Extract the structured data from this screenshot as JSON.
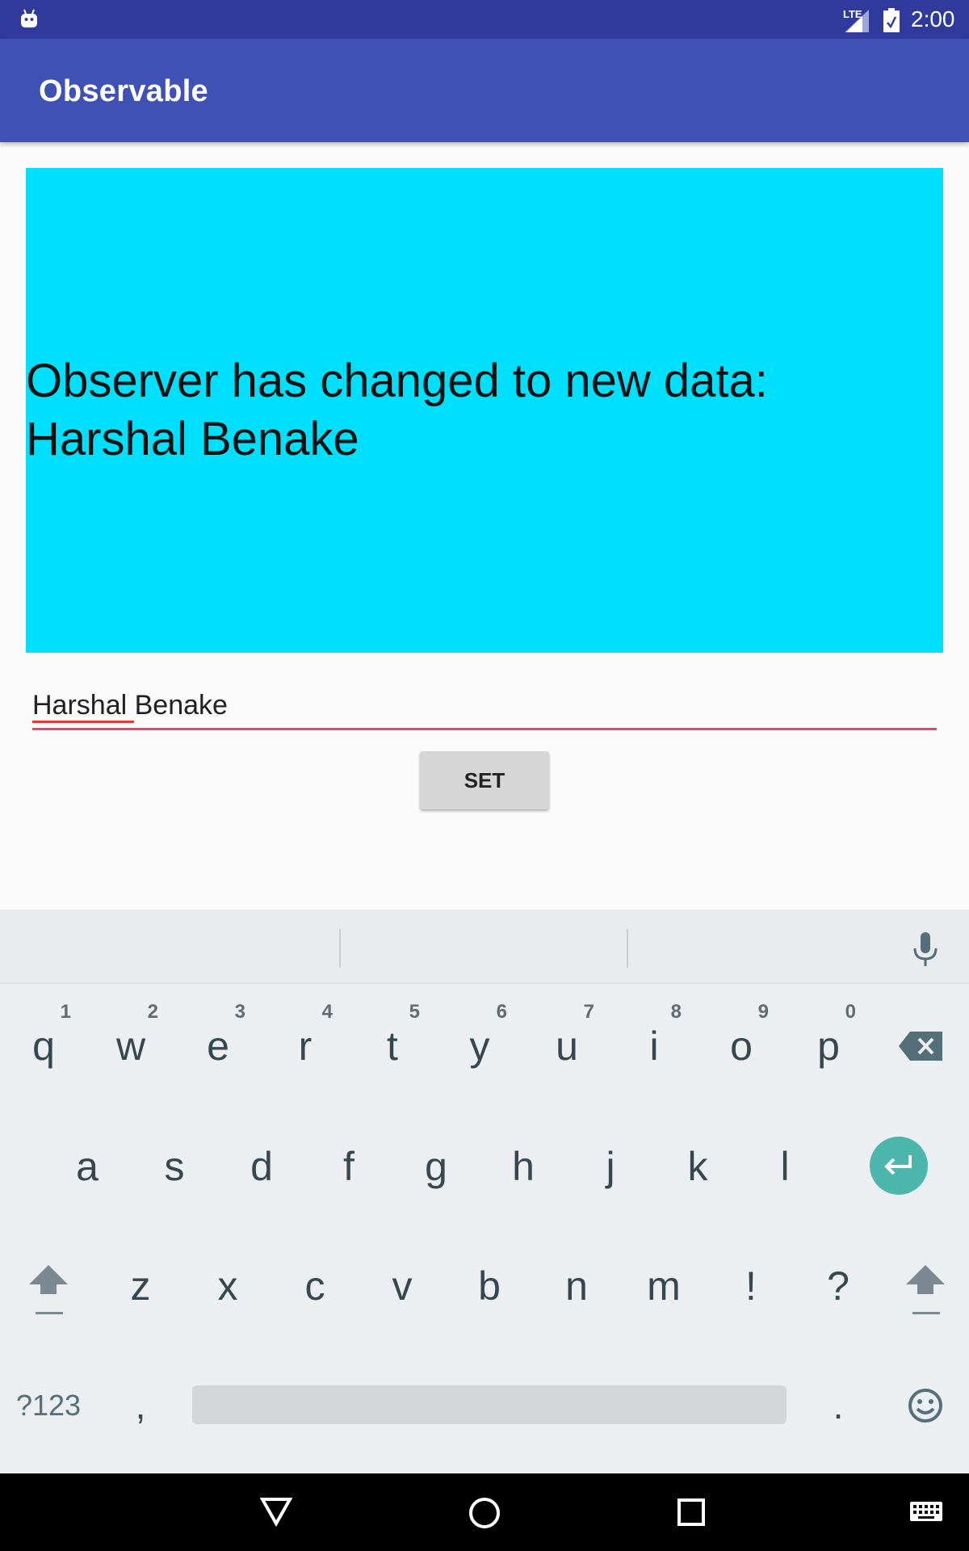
{
  "status_bar": {
    "network_label": "LTE",
    "time": "2:00",
    "icons": [
      "android-icon",
      "signal-icon",
      "battery-icon"
    ]
  },
  "app_bar": {
    "title": "Observable"
  },
  "observer_panel": {
    "line1": "Observer has changed to new data:",
    "line2": "Harshal Benake",
    "background_color": "#00e0fc"
  },
  "name_field": {
    "value": "Harshal Benake",
    "underline_color": "#e8456b"
  },
  "set_button": {
    "label": "SET"
  },
  "keyboard": {
    "row1": [
      {
        "letter": "q",
        "hint": "1"
      },
      {
        "letter": "w",
        "hint": "2"
      },
      {
        "letter": "e",
        "hint": "3"
      },
      {
        "letter": "r",
        "hint": "4"
      },
      {
        "letter": "t",
        "hint": "5"
      },
      {
        "letter": "y",
        "hint": "6"
      },
      {
        "letter": "u",
        "hint": "7"
      },
      {
        "letter": "i",
        "hint": "8"
      },
      {
        "letter": "o",
        "hint": "9"
      },
      {
        "letter": "p",
        "hint": "0"
      }
    ],
    "row2": [
      "a",
      "s",
      "d",
      "f",
      "g",
      "h",
      "j",
      "k",
      "l"
    ],
    "row3": [
      "z",
      "x",
      "c",
      "v",
      "b",
      "n",
      "m",
      "!",
      "?"
    ],
    "symbols_label": "?123",
    "comma_label": ",",
    "period_label": ".",
    "icons": [
      "backspace-icon",
      "enter-icon",
      "shift-icon",
      "mic-icon",
      "emoji-icon"
    ],
    "enter_color": "#4db6ac"
  },
  "nav_bar": {
    "icons": [
      "back-icon",
      "home-icon",
      "recents-icon",
      "keyboard-switch-icon"
    ]
  }
}
